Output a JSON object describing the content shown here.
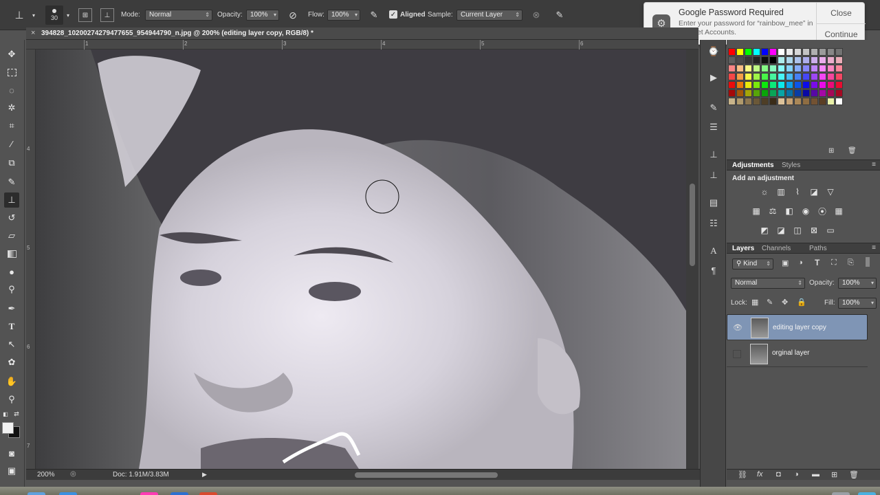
{
  "options_bar": {
    "brush_size": "30",
    "mode_label": "Mode:",
    "mode_value": "Normal",
    "opacity_label": "Opacity:",
    "opacity_value": "100%",
    "flow_label": "Flow:",
    "flow_value": "100%",
    "aligned_label": "Aligned",
    "aligned_checked": true,
    "sample_label": "Sample:",
    "sample_value": "Current Layer"
  },
  "document": {
    "tab_title": "394828_10200274279477655_954944790_n.jpg @ 200% (editing layer copy, RGB/8) *",
    "close_symbol": "×",
    "ruler_top": [
      "1",
      "2",
      "3",
      "4",
      "5",
      "6"
    ],
    "ruler_left": [
      "4",
      "5",
      "6",
      "7"
    ]
  },
  "status_bar": {
    "zoom": "200%",
    "doc_info": "Doc: 1.91M/3.83M"
  },
  "notification": {
    "title": "Google Password Required",
    "body": "Enter your password for “rainbow_mee” in Internet Accounts.",
    "close_label": "Close",
    "continue_label": "Continue"
  },
  "adjustments_panel": {
    "tabs": [
      "Adjustments",
      "Styles"
    ],
    "heading": "Add an adjustment"
  },
  "layers_panel": {
    "tabs": [
      "Layers",
      "Channels",
      "Paths"
    ],
    "filter_kind": "Kind",
    "blend_mode": "Normal",
    "opacity_label": "Opacity:",
    "opacity_value": "100%",
    "lock_label": "Lock:",
    "fill_label": "Fill:",
    "fill_value": "100%",
    "layers": [
      {
        "name": "editing layer copy",
        "visible": true,
        "selected": true
      },
      {
        "name": "orginal layer",
        "visible": false,
        "selected": false
      }
    ]
  },
  "tools": [
    "move-tool",
    "marquee-tool",
    "lasso-tool",
    "quick-select-tool",
    "crop-tool",
    "eyedropper-tool",
    "healing-brush-tool",
    "brush-tool",
    "clone-stamp-tool",
    "history-brush-tool",
    "eraser-tool",
    "gradient-tool",
    "blur-tool",
    "dodge-tool",
    "pen-tool",
    "type-tool",
    "path-select-tool",
    "shape-tool",
    "hand-tool",
    "zoom-tool"
  ],
  "swatch_colors": {
    "row1": [
      "#ff0000",
      "#ffff00",
      "#00ff00",
      "#00ffff",
      "#0000ff",
      "#ff00ff",
      "#ffffff",
      "#ebebeb",
      "#d7d7d7",
      "#c3c3c3",
      "#afafaf",
      "#9b9b9b",
      "#878787",
      "#737373"
    ],
    "row2": [
      "#5f5f5f",
      "#4b4b4b",
      "#373737",
      "#232323",
      "#0f0f0f",
      "#000000"
    ],
    "accent_selected_layer": "#7f95b5"
  }
}
